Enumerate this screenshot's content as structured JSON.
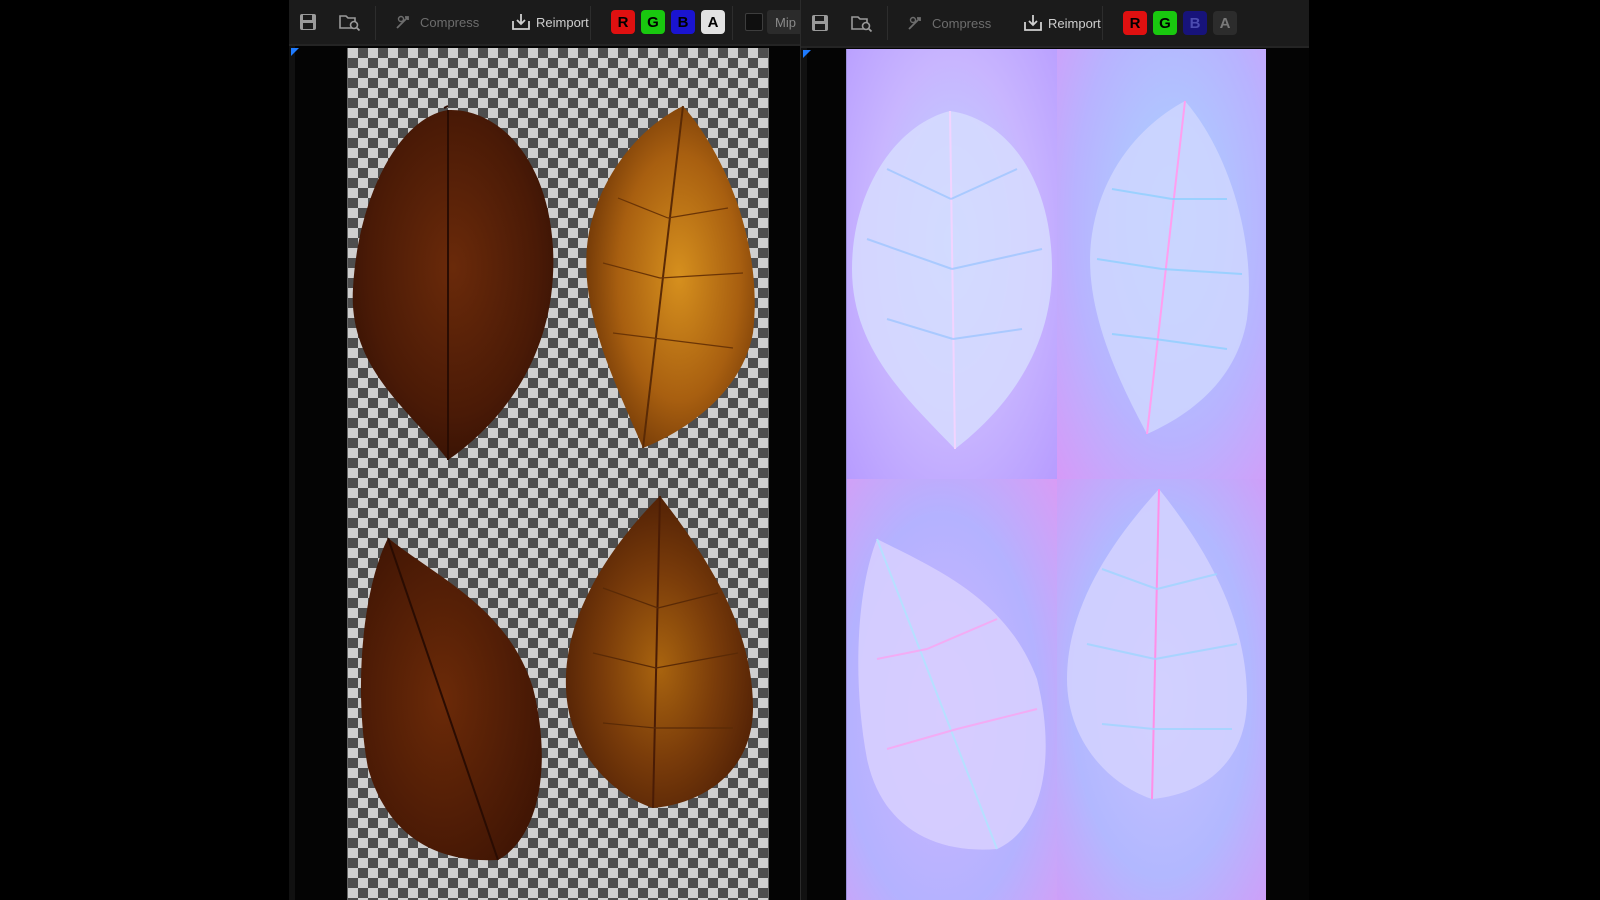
{
  "left_editor": {
    "toolbar": {
      "save_icon": "save-icon",
      "browse_icon": "browse-asset-icon",
      "compress_label": "Compress",
      "reimport_label": "Reimport",
      "channels": [
        "R",
        "G",
        "B",
        "A"
      ],
      "mip_label": "Mip"
    }
  },
  "right_editor": {
    "toolbar": {
      "save_icon": "save-icon",
      "browse_icon": "browse-asset-icon",
      "compress_label": "Compress",
      "reimport_label": "Reimport",
      "channels": [
        "R",
        "G",
        "B",
        "A"
      ]
    }
  },
  "colors": {
    "channel_red": "#e01010",
    "channel_green": "#19c80f",
    "channel_blue": "#1a14d0",
    "channel_alpha": "#e2e2e2",
    "viewport_marker": "#1e7bff",
    "leaf_dark_brown": "#4a1a06",
    "leaf_golden": "#b06a12",
    "normal_map_base": "#b8b3ff"
  }
}
